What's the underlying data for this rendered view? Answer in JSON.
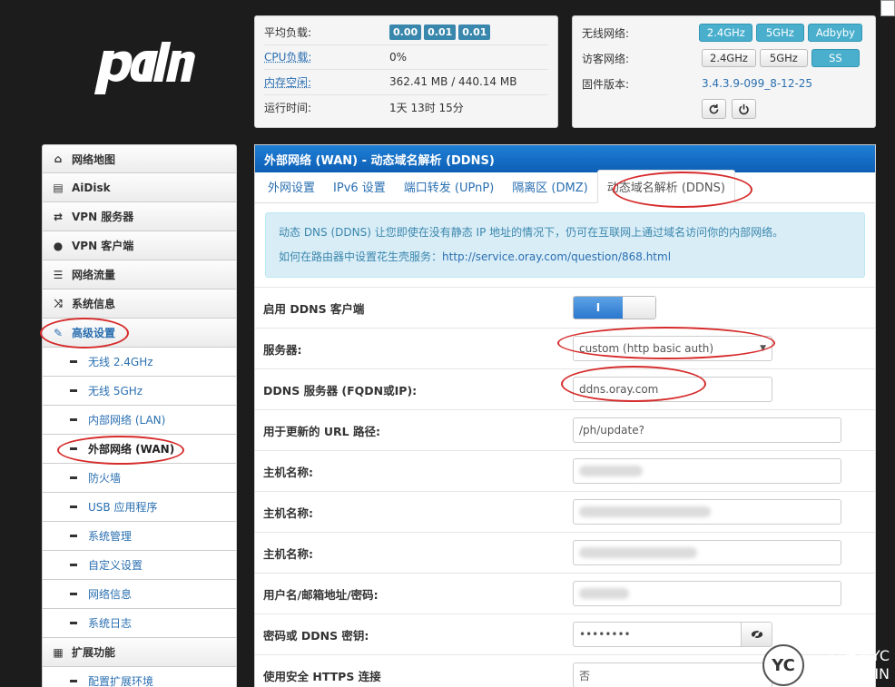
{
  "status": {
    "load_label": "平均负载:",
    "load_values": [
      "0.00",
      "0.01",
      "0.01"
    ],
    "cpu_label": "CPU负载:",
    "cpu_value": "0%",
    "mem_label": "内存空闲:",
    "mem_value": "362.41 MB / 440.14 MB",
    "uptime_label": "运行时间:",
    "uptime_value": "1天 13时 15分"
  },
  "network": {
    "wireless_label": "无线网络:",
    "wireless_buttons": [
      "2.4GHz",
      "5GHz",
      "Adbyby"
    ],
    "guest_label": "访客网络:",
    "guest_buttons": [
      "2.4GHz",
      "5GHz",
      "SS"
    ],
    "firmware_label": "固件版本:",
    "firmware_value": "3.4.3.9-099_8-12-25"
  },
  "sidebar": {
    "items": [
      {
        "label": "网络地图"
      },
      {
        "label": "AiDisk"
      },
      {
        "label": "VPN 服务器"
      },
      {
        "label": "VPN 客户端"
      },
      {
        "label": "网络流量"
      },
      {
        "label": "系统信息"
      },
      {
        "label": "高级设置"
      }
    ],
    "sub_items": [
      {
        "label": "无线 2.4GHz"
      },
      {
        "label": "无线 5GHz"
      },
      {
        "label": "内部网络 (LAN)"
      },
      {
        "label": "外部网络 (WAN)"
      },
      {
        "label": "防火墙"
      },
      {
        "label": "USB 应用程序"
      },
      {
        "label": "系统管理"
      },
      {
        "label": "自定义设置"
      },
      {
        "label": "网络信息"
      },
      {
        "label": "系统日志"
      }
    ],
    "ext_label": "扩展功能",
    "ext_sub": "配置扩展环境"
  },
  "main": {
    "title": "外部网络 (WAN) - 动态域名解析 (DDNS)",
    "tabs": [
      "外网设置",
      "IPv6 设置",
      "端口转发 (UPnP)",
      "隔离区 (DMZ)",
      "动态域名解析 (DDNS)"
    ],
    "info_line1": "动态 DNS (DDNS) 让您即使在没有静态 IP 地址的情况下，仍可在互联网上通过域名访问你的内部网络。",
    "info_line2_prefix": "如何在路由器中设置花生壳服务：",
    "info_link": "http://service.oray.com/question/868.html",
    "form": {
      "enable_label": "启用 DDNS 客户端",
      "toggle_on": "I",
      "server_label": "服务器:",
      "server_value": "custom (http basic auth)",
      "fqdn_label": "DDNS 服务器 (FQDN或IP):",
      "fqdn_value": "ddns.oray.com",
      "url_label": "用于更新的 URL 路径:",
      "url_value": "/ph/update?",
      "host1_label": "主机名称:",
      "host2_label": "主机名称:",
      "host3_label": "主机名称:",
      "user_label": "用户名/邮箱地址/密码:",
      "secret_label": "密码或 DDNS 密钥:",
      "secret_value": "••••••••",
      "https_label": "使用安全 HTTPS 连接",
      "https_value": "否"
    }
  },
  "watermark": {
    "line1": "©渊澄YC",
    "line2": "YCYC.WIN",
    "logo": "YC"
  }
}
